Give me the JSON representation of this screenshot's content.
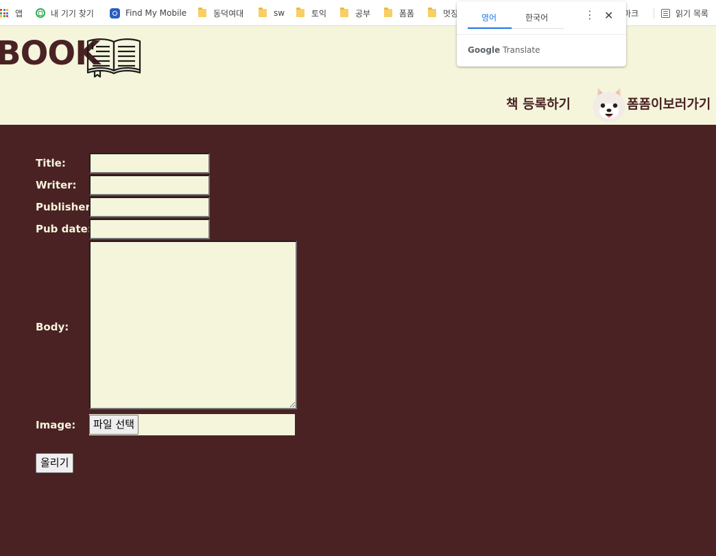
{
  "bookmarks": {
    "items": [
      {
        "label": "앱",
        "icon": "apps-grid-icon"
      },
      {
        "label": "내 기기 찾기",
        "icon": "find-device-icon"
      },
      {
        "label": "Find My Mobile",
        "icon": "samsung-icon"
      },
      {
        "label": "동덕여대",
        "icon": "folder-icon"
      },
      {
        "label": "sw",
        "icon": "folder-icon"
      },
      {
        "label": "토익",
        "icon": "folder-icon"
      },
      {
        "label": "공부",
        "icon": "folder-icon"
      },
      {
        "label": "폼폼",
        "icon": "folder-icon"
      },
      {
        "label": "멋징",
        "icon": "folder-icon"
      }
    ],
    "partial_label": "북마크",
    "reading_list": {
      "label": "읽기 목록",
      "icon": "reading-list-icon"
    }
  },
  "translate_popup": {
    "tab_active": "영어",
    "tab_other": "한국어",
    "brand_google": "Google",
    "brand_translate": "Translate",
    "more_icon": "⋮",
    "close_icon": "✕"
  },
  "header": {
    "logo_text": "BOOK",
    "logo_icon": "open-book-icon",
    "nav_register": "책 등록하기",
    "nav_pompom": "폼폼이보러가기",
    "avatar_alt": "pomeranian"
  },
  "form": {
    "title_label": "Title:",
    "writer_label": "Writer:",
    "publisher_label": "Publisher:",
    "pubdate_label": "Pub date:",
    "body_label": "Body:",
    "image_label": "Image:",
    "file_button": "파일 선택",
    "submit_button": "올리기"
  },
  "colors": {
    "page_background": "#4a2224",
    "header_background": "#f5f5dc",
    "accent_text": "#4a2224",
    "label_text": "#f5f5dc"
  }
}
